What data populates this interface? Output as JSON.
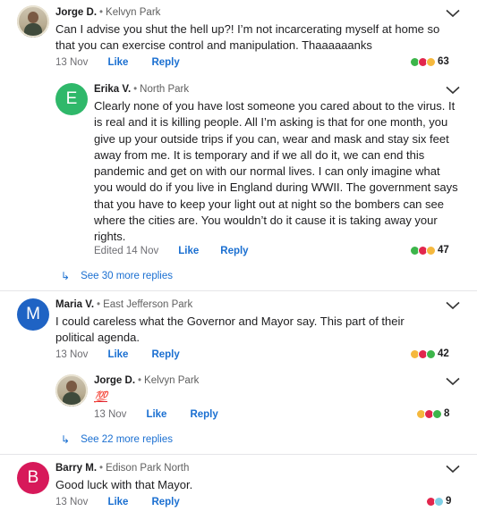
{
  "comments": [
    {
      "name": "Jorge D.",
      "sep": "•",
      "location": "Kelvyn Park",
      "text": "Can I advise you shut the hell up?! I’m not incarcerating myself at home so that you can exercise control and manipulation.  Thaaaaaanks",
      "date": "13 Nov",
      "like_label": "Like",
      "reply_label": "Reply",
      "reaction_count": "63"
    },
    {
      "name": "Erika V.",
      "sep": "•",
      "location": "North Park",
      "avatar_letter": "E",
      "avatar_color": "#2fb86a",
      "text": "Clearly none of you have lost someone you cared about to the virus.  It is real and it is killing people.  All I’m asking is that for one month, you give up your outside trips if you can, wear and mask and stay six feet away from me.  It is temporary and if we all do it, we can end this pandemic and get on with our normal lives.  I can only imagine what you would do if you live in England during WWII.  The government says that you have to keep your light out at night so the bombers can see where the cities are.  You wouldn’t do it cause it is taking away your rights.",
      "date": "Edited 14 Nov",
      "like_label": "Like",
      "reply_label": "Reply",
      "reaction_count": "47"
    },
    {
      "name": "Maria V.",
      "sep": "•",
      "location": "East Jefferson Park",
      "avatar_letter": "M",
      "avatar_color": "#1f63c4",
      "text": "I could careless what the Governor and Mayor say.  This part of their political agenda.",
      "date": "13 Nov",
      "like_label": "Like",
      "reply_label": "Reply",
      "reaction_count": "42"
    },
    {
      "name": "Jorge D.",
      "sep": "•",
      "location": "Kelvyn Park",
      "text": "💯",
      "date": "13 Nov",
      "like_label": "Like",
      "reply_label": "Reply",
      "reaction_count": "8"
    },
    {
      "name": "Barry M.",
      "sep": "•",
      "location": "Edison Park North",
      "avatar_letter": "B",
      "avatar_color": "#d7195a",
      "text": "Good luck with that Mayor.",
      "date": "13 Nov",
      "like_label": "Like",
      "reply_label": "Reply",
      "reaction_count": "9"
    }
  ],
  "see_more": [
    {
      "label": "See 30 more replies"
    },
    {
      "label": "See 22 more replies"
    }
  ],
  "colors": {
    "link": "#1a6fd1",
    "reaction_agree": "#3cb54a",
    "reaction_heart": "#e2264d",
    "reaction_haha": "#f5b83d",
    "reaction_sad": "#7fd0e6"
  },
  "icons": {
    "more": "chevron-down-icon",
    "see_more": "reply-arrow-icon"
  }
}
